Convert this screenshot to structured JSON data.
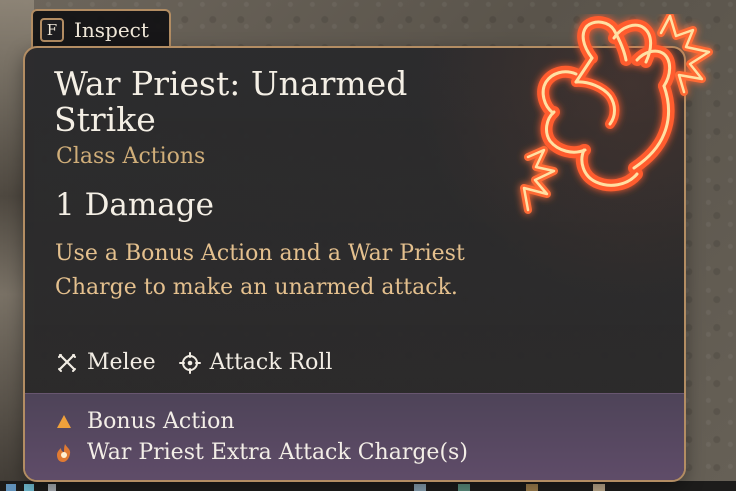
{
  "inspect": {
    "key": "F",
    "label": "Inspect"
  },
  "tooltip": {
    "title": "War Priest: Unarmed Strike",
    "category": "Class Actions",
    "damage": "1 Damage",
    "description": "Use a Bonus Action and a War Priest Charge to make an unarmed attack.",
    "meta": [
      {
        "label": "Melee",
        "icon": "crossed-blades-icon"
      },
      {
        "label": "Attack Roll",
        "icon": "target-icon"
      }
    ],
    "costs": [
      {
        "label": "Bonus Action",
        "icon": "bonus-action-triangle-icon",
        "color": "#f0a13b"
      },
      {
        "label": "War Priest Extra Attack Charge(s)",
        "icon": "flame-charge-icon",
        "color": "#e07a32"
      }
    ]
  },
  "colors": {
    "card_border": "#b38d63",
    "card_bg": "#2a2a2a",
    "title": "#f4efe5",
    "category": "#d0ae79",
    "description": "#e4c08e",
    "footer_bg": "#5f4f6d",
    "fist_glow": "#ff5b2e"
  },
  "icons": {
    "spell_icon": "fist-icon"
  }
}
